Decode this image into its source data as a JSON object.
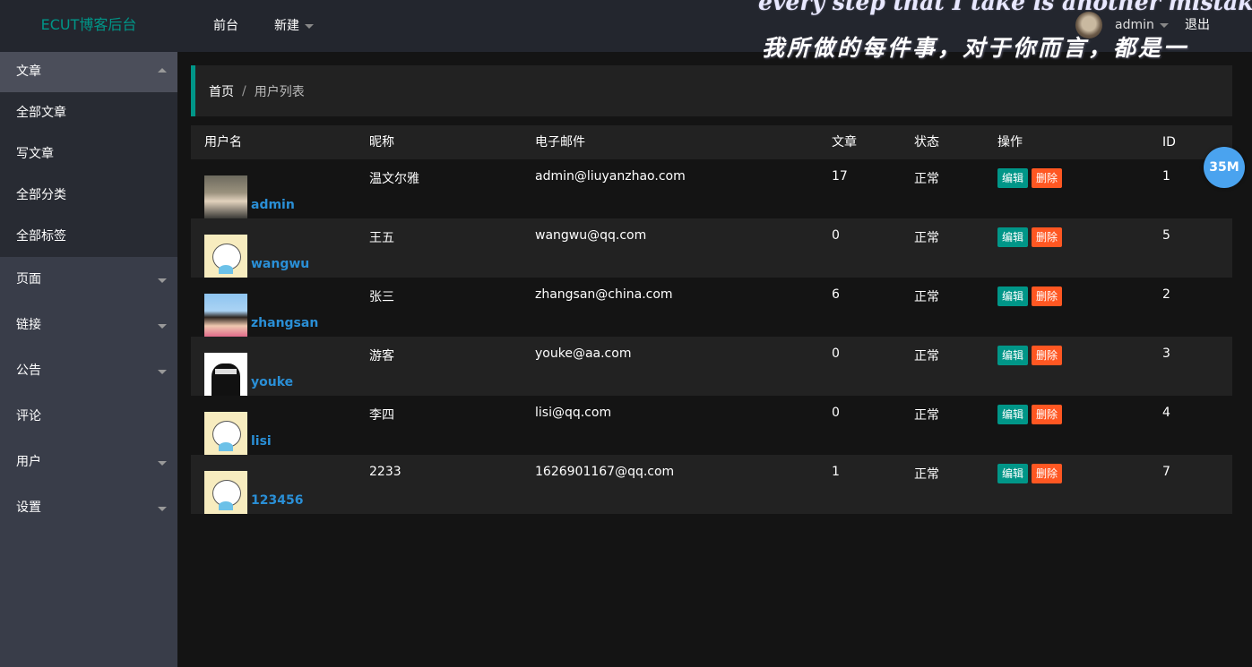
{
  "header": {
    "logo": "ECUT博客后台",
    "nav": [
      {
        "label": "前台"
      },
      {
        "label": "新建"
      }
    ],
    "banner_line1": "every step that I take is another mistake to",
    "banner_line2": "我所做的每件事，对于你而言，都是一",
    "user_name": "admin",
    "logout": "退出"
  },
  "sidebar": {
    "article": {
      "title": "文章",
      "items": [
        "全部文章",
        "写文章",
        "全部分类",
        "全部标签"
      ]
    },
    "groups": [
      "页面",
      "链接",
      "公告",
      "评论",
      "用户",
      "设置"
    ]
  },
  "breadcrumb": {
    "home": "首页",
    "separator": "/",
    "current": "用户列表"
  },
  "table": {
    "headers": [
      "用户名",
      "昵称",
      "电子邮件",
      "文章",
      "状态",
      "操作",
      "ID"
    ],
    "edit_label": "编辑",
    "delete_label": "删除",
    "rows": [
      {
        "username": "admin",
        "nickname": "温文尔雅",
        "email": "admin@liuyanzhao.com",
        "articles": "17",
        "status": "正常",
        "id": "1"
      },
      {
        "username": "wangwu",
        "nickname": "王五",
        "email": "wangwu@qq.com",
        "articles": "0",
        "status": "正常",
        "id": "5"
      },
      {
        "username": "zhangsan",
        "nickname": "张三",
        "email": "zhangsan@china.com",
        "articles": "6",
        "status": "正常",
        "id": "2"
      },
      {
        "username": "youke",
        "nickname": "游客",
        "email": "youke@aa.com",
        "articles": "0",
        "status": "正常",
        "id": "3"
      },
      {
        "username": "lisi",
        "nickname": "李四",
        "email": "lisi@qq.com",
        "articles": "0",
        "status": "正常",
        "id": "4"
      },
      {
        "username": "123456",
        "nickname": "2233",
        "email": "1626901167@qq.com",
        "articles": "1",
        "status": "正常",
        "id": "7"
      }
    ]
  },
  "memory_badge": "35M",
  "colors": {
    "accent": "#009688",
    "danger": "#ff5722",
    "link": "#2a8fd6",
    "header_bg": "#23262e",
    "sidebar_bg": "#393d49"
  }
}
